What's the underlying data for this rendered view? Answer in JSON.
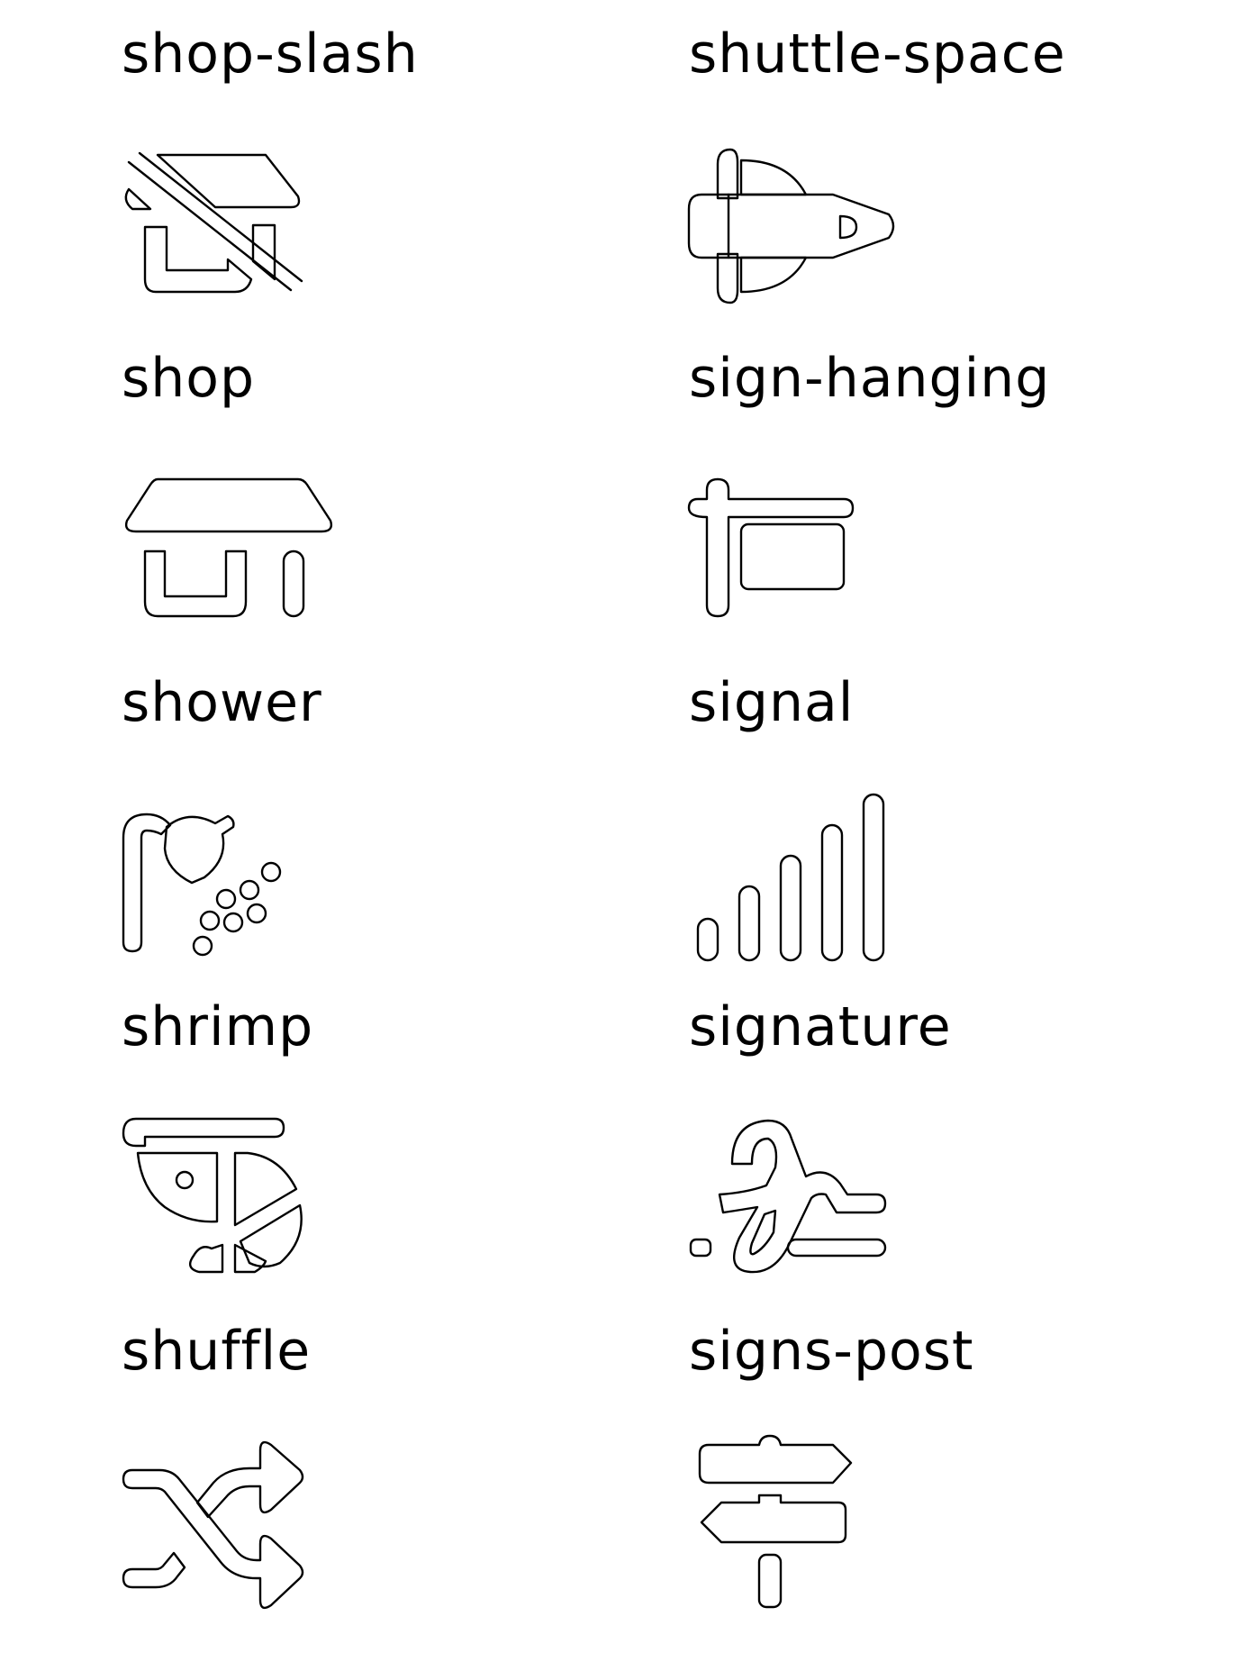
{
  "icons": [
    {
      "label": "shop-slash",
      "icon": "shop-slash-icon"
    },
    {
      "label": "shuttle-space",
      "icon": "shuttle-space-icon"
    },
    {
      "label": "shop",
      "icon": "shop-icon"
    },
    {
      "label": "sign-hanging",
      "icon": "sign-hanging-icon"
    },
    {
      "label": "shower",
      "icon": "shower-icon"
    },
    {
      "label": "signal",
      "icon": "signal-icon"
    },
    {
      "label": "shrimp",
      "icon": "shrimp-icon"
    },
    {
      "label": "signature",
      "icon": "signature-icon"
    },
    {
      "label": "shuffle",
      "icon": "shuffle-icon"
    },
    {
      "label": "signs-post",
      "icon": "signs-post-icon"
    }
  ]
}
